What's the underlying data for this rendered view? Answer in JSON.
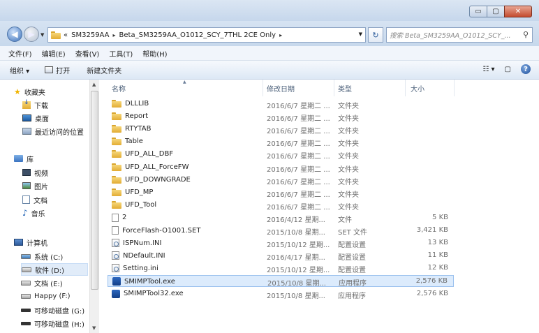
{
  "window": {
    "caption_buttons": {
      "minimize": "▭",
      "maximize": "▢",
      "close": "✕"
    }
  },
  "nav": {
    "back_glyph": "◀",
    "forward_glyph": "▶",
    "address": {
      "prefix": "«",
      "crumbs": [
        "SM3259AA",
        "Beta_SM3259AA_O1012_SCY_7THL 2CE Only"
      ],
      "separator": "▸"
    },
    "refresh_glyph": "↻",
    "search_placeholder": "搜索 Beta_SM3259AA_O1012_SCY_...",
    "search_glyph": "⚲"
  },
  "menu": [
    "文件(F)",
    "编辑(E)",
    "查看(V)",
    "工具(T)",
    "帮助(H)"
  ],
  "toolbar": {
    "organize": "组织 ▾",
    "open": "打开",
    "new_folder": "新建文件夹",
    "views_glyph": "☷ ▾",
    "preview_glyph": "▢",
    "help_glyph": "?"
  },
  "navpane": {
    "favorites": "收藏夹",
    "downloads": "下载",
    "desktop": "桌面",
    "recent": "最近访问的位置",
    "libraries": "库",
    "videos": "视频",
    "pictures": "图片",
    "documents": "文档",
    "music": "音乐",
    "computer": "计算机",
    "drives": [
      {
        "label": "系统 (C:)",
        "kind": "sys"
      },
      {
        "label": "软件 (D:)",
        "kind": "drive"
      },
      {
        "label": "文档 (E:)",
        "kind": "drive"
      },
      {
        "label": "Happy (F:)",
        "kind": "drive"
      },
      {
        "label": "可移动磁盘 (G:)",
        "kind": "usb"
      },
      {
        "label": "可移动磁盘 (H:)",
        "kind": "usb"
      }
    ],
    "selected_drive_index": 1
  },
  "columns": {
    "name": "名称",
    "date": "修改日期",
    "type": "类型",
    "size": "大小"
  },
  "files": [
    {
      "name": "DLLLIB",
      "date": "2016/6/7 星期二 ...",
      "type": "文件夹",
      "size": "",
      "icon": "folder"
    },
    {
      "name": "Report",
      "date": "2016/6/7 星期二 ...",
      "type": "文件夹",
      "size": "",
      "icon": "folder"
    },
    {
      "name": "RTYTAB",
      "date": "2016/6/7 星期二 ...",
      "type": "文件夹",
      "size": "",
      "icon": "folder"
    },
    {
      "name": "Table",
      "date": "2016/6/7 星期二 ...",
      "type": "文件夹",
      "size": "",
      "icon": "folder"
    },
    {
      "name": "UFD_ALL_DBF",
      "date": "2016/6/7 星期二 ...",
      "type": "文件夹",
      "size": "",
      "icon": "folder"
    },
    {
      "name": "UFD_ALL_ForceFW",
      "date": "2016/6/7 星期二 ...",
      "type": "文件夹",
      "size": "",
      "icon": "folder"
    },
    {
      "name": "UFD_DOWNGRADE",
      "date": "2016/6/7 星期二 ...",
      "type": "文件夹",
      "size": "",
      "icon": "folder"
    },
    {
      "name": "UFD_MP",
      "date": "2016/6/7 星期二 ...",
      "type": "文件夹",
      "size": "",
      "icon": "folder"
    },
    {
      "name": "UFD_Tool",
      "date": "2016/6/7 星期二 ...",
      "type": "文件夹",
      "size": "",
      "icon": "folder"
    },
    {
      "name": "2",
      "date": "2016/4/12 星期...",
      "type": "文件",
      "size": "5 KB",
      "icon": "doc"
    },
    {
      "name": "ForceFlash-O1001.SET",
      "date": "2015/10/8 星期...",
      "type": "SET 文件",
      "size": "3,421 KB",
      "icon": "doc"
    },
    {
      "name": "ISPNum.INI",
      "date": "2015/10/12 星期...",
      "type": "配置设置",
      "size": "13 KB",
      "icon": "cfg"
    },
    {
      "name": "NDefault.INI",
      "date": "2016/4/17 星期...",
      "type": "配置设置",
      "size": "11 KB",
      "icon": "cfg"
    },
    {
      "name": "Setting.ini",
      "date": "2015/10/12 星期...",
      "type": "配置设置",
      "size": "12 KB",
      "icon": "cfg"
    },
    {
      "name": "SMIMPTool.exe",
      "date": "2015/10/8 星期...",
      "type": "应用程序",
      "size": "2,576 KB",
      "icon": "exe"
    },
    {
      "name": "SMIMPTool32.exe",
      "date": "2015/10/8 星期...",
      "type": "应用程序",
      "size": "2,576 KB",
      "icon": "exe"
    }
  ],
  "selected_file_index": 14
}
